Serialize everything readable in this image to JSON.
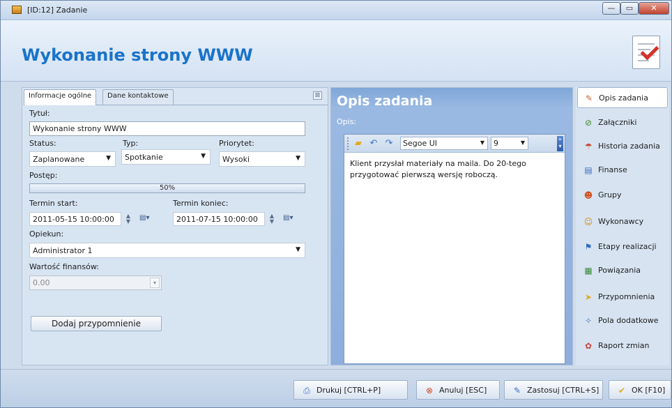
{
  "window": {
    "title": "[ID:12] Zadanie",
    "minimize_glyph": "—",
    "maximize_glyph": "▭",
    "close_glyph": "✕"
  },
  "header": {
    "title": "Wykonanie strony WWW",
    "icon": "document-check-icon"
  },
  "left_panel": {
    "tabs": [
      {
        "label": "Informacje ogólne",
        "active": true
      },
      {
        "label": "Dane kontaktowe",
        "active": false
      }
    ],
    "close_glyph": "⊠",
    "title_label": "Tytuł:",
    "title_value": "Wykonanie strony WWW",
    "status_label": "Status:",
    "status_value": "Zaplanowane",
    "type_label": "Typ:",
    "type_value": "Spotkanie",
    "priority_label": "Priorytet:",
    "priority_value": "Wysoki",
    "progress_label": "Postęp:",
    "progress_text": "50%",
    "progress_fraction": 0.0,
    "start_label": "Termin start:",
    "start_value": "2011-05-15  10:00:00",
    "end_label": "Termin koniec:",
    "end_value": "2011-07-15  10:00:00",
    "caretaker_label": "Opiekun:",
    "caretaker_value": "Administrator 1",
    "finance_label": "Wartość finansów:",
    "finance_value": "0.00",
    "add_reminder_label": "Dodaj przypomnienie",
    "dropdown_glyph": "▼"
  },
  "center_panel": {
    "title": "Opis zadania",
    "opis_label": "Opis:",
    "font_name": "Segoe UI",
    "font_size": "9",
    "text": "Klient przysłał materiały na maila. Do 20-tego przygotować pierwszą wersję roboczą."
  },
  "right_nav": {
    "items": [
      {
        "label": "Opis zadania",
        "icon": "pencil-icon",
        "active": true
      },
      {
        "label": "Załączniki",
        "icon": "paperclip-icon",
        "active": false
      },
      {
        "label": "Historia zadania",
        "icon": "history-icon",
        "active": false
      },
      {
        "label": "Finanse",
        "icon": "finance-icon",
        "active": false
      },
      {
        "label": "Grupy",
        "icon": "groups-icon",
        "active": false
      },
      {
        "label": "Wykonawcy",
        "icon": "users-icon",
        "active": false
      },
      {
        "label": "Etapy realizacji",
        "icon": "stages-icon",
        "active": false
      },
      {
        "label": "Powiązania",
        "icon": "link-icon",
        "active": false
      },
      {
        "label": "Przypomnienia",
        "icon": "bell-icon",
        "active": false
      },
      {
        "label": "Pola dodatkowe",
        "icon": "fields-icon",
        "active": false
      },
      {
        "label": "Raport zmian",
        "icon": "report-icon",
        "active": false
      }
    ]
  },
  "footer": {
    "print": "Drukuj [CTRL+P]",
    "cancel": "Anuluj [ESC]",
    "apply": "Zastosuj [CTRL+S]",
    "ok": "OK [F10]"
  },
  "colors": {
    "title_blue": "#1a73c9",
    "panel_blue": "#8daedd"
  }
}
